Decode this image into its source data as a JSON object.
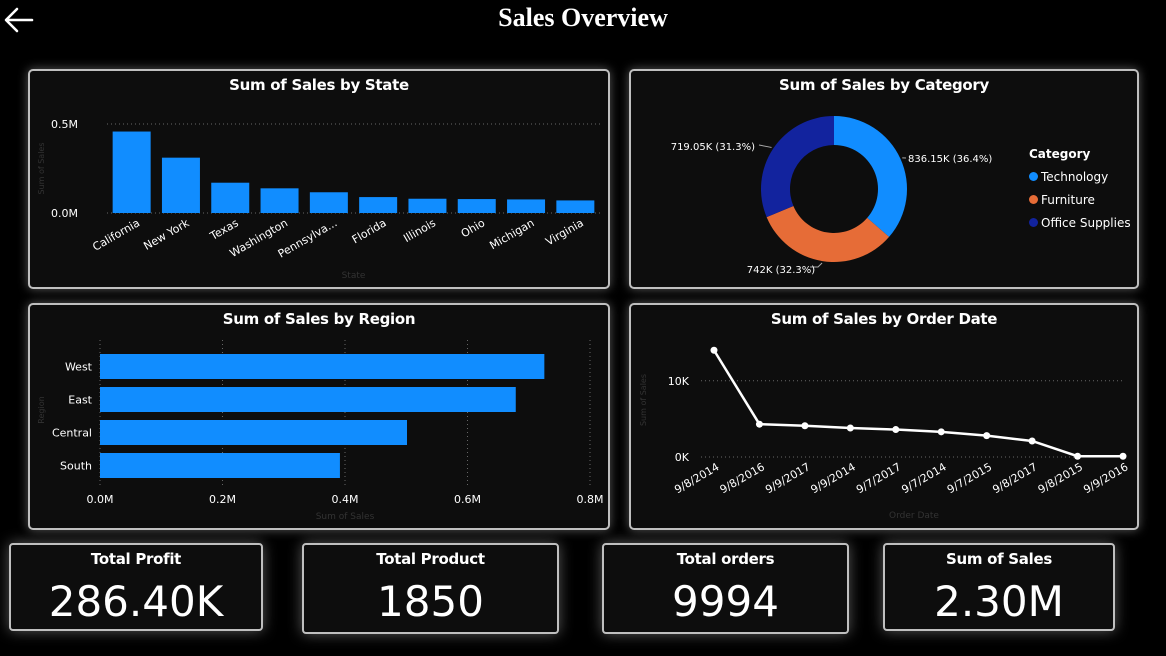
{
  "page": {
    "title": "Sales Overview"
  },
  "kpis": [
    {
      "label": "Total Profit",
      "value": "286.40K"
    },
    {
      "label": "Total Product",
      "value": "1850"
    },
    {
      "label": "Total orders",
      "value": "9994"
    },
    {
      "label": "Sum of Sales",
      "value": "2.30M"
    }
  ],
  "chart_data": [
    {
      "type": "bar",
      "title": "Sum of Sales by State",
      "xlabel": "State",
      "ylabel": "Sum of Sales",
      "categories": [
        "California",
        "New York",
        "Texas",
        "Washington",
        "Pennsylva...",
        "Florida",
        "Illinois",
        "Ohio",
        "Michigan",
        "Virginia"
      ],
      "values": [
        457688,
        310876,
        170188,
        138641,
        116512,
        89474,
        80166,
        78258,
        76270,
        70637
      ],
      "yticks": [
        "0.0M",
        "0.5M"
      ],
      "ylim": [
        0,
        500000
      ],
      "color": "#118dff"
    },
    {
      "type": "pie",
      "title": "Sum of Sales by Category",
      "legend_title": "Category",
      "labels": [
        "Technology",
        "Furniture",
        "Office Supplies"
      ],
      "values": [
        836.15,
        742,
        719.05
      ],
      "data_labels": [
        "836.15K (36.4%)",
        "742K (32.3%)",
        "719.05K (31.3%)"
      ],
      "colors": [
        "#118dff",
        "#e66c37",
        "#12239e"
      ]
    },
    {
      "type": "bar",
      "orientation": "horizontal",
      "title": "Sum of Sales by Region",
      "xlabel": "Sum of Sales",
      "ylabel": "Region",
      "categories": [
        "West",
        "East",
        "Central",
        "South"
      ],
      "values": [
        725458,
        678781,
        501240,
        391722
      ],
      "xticks": [
        "0.0M",
        "0.2M",
        "0.4M",
        "0.6M",
        "0.8M"
      ],
      "xlim": [
        0,
        800000
      ],
      "color": "#118dff"
    },
    {
      "type": "line",
      "title": "Sum of Sales by Order Date",
      "xlabel": "Order Date",
      "ylabel": "Sum of Sales",
      "x": [
        "9/8/2014",
        "9/8/2016",
        "9/9/2017",
        "9/9/2014",
        "9/7/2017",
        "9/7/2014",
        "9/7/2015",
        "9/8/2017",
        "9/8/2015",
        "9/9/2016"
      ],
      "values": [
        14000,
        4300,
        4100,
        3800,
        3600,
        3300,
        2800,
        2100,
        100,
        100
      ],
      "yticks": [
        "0K",
        "10K"
      ],
      "ylim": [
        0,
        16000
      ],
      "color": "#ffffff"
    }
  ]
}
